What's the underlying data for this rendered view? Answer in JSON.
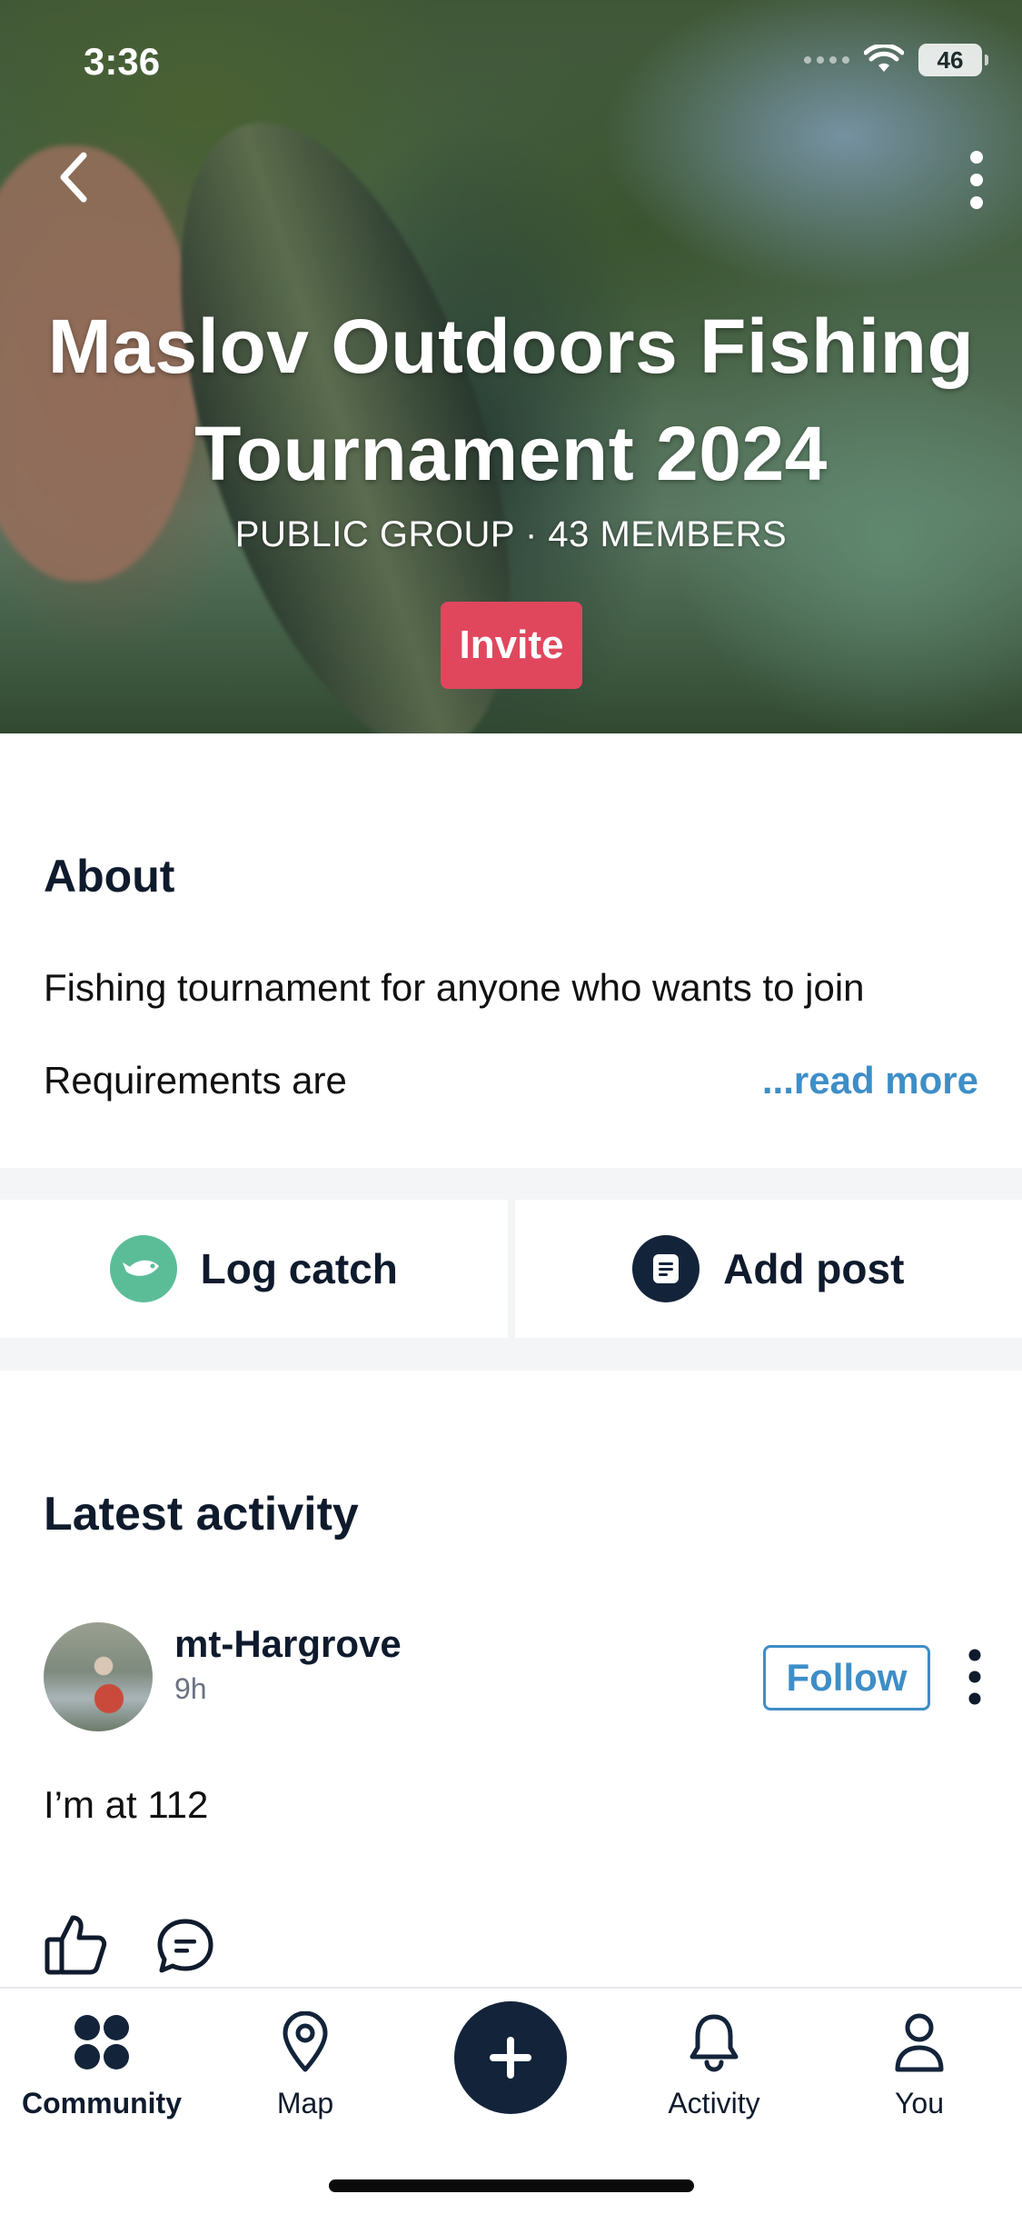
{
  "status_bar": {
    "time": "3:36",
    "battery": "46"
  },
  "header": {
    "title": "Maslov Outdoors Fishing Tournament 2024",
    "subtitle": "PUBLIC GROUP · 43 MEMBERS",
    "invite_label": "Invite"
  },
  "about": {
    "heading": "About",
    "line1": "Fishing tournament for anyone who wants to join",
    "line2": "Requirements are",
    "read_more": "...read more"
  },
  "actions": {
    "log_catch": "Log catch",
    "add_post": "Add post"
  },
  "activity": {
    "heading": "Latest activity",
    "post": {
      "username": "mt-Hargrove",
      "time": "9h",
      "follow_label": "Follow",
      "text": "I’m at 112"
    }
  },
  "tabbar": {
    "community": "Community",
    "map": "Map",
    "activity": "Activity",
    "you": "You"
  },
  "colors": {
    "invite": "#e0475d",
    "link": "#3e8ec7",
    "log_catch_icon": "#5bbd98",
    "navy": "#13243a"
  }
}
